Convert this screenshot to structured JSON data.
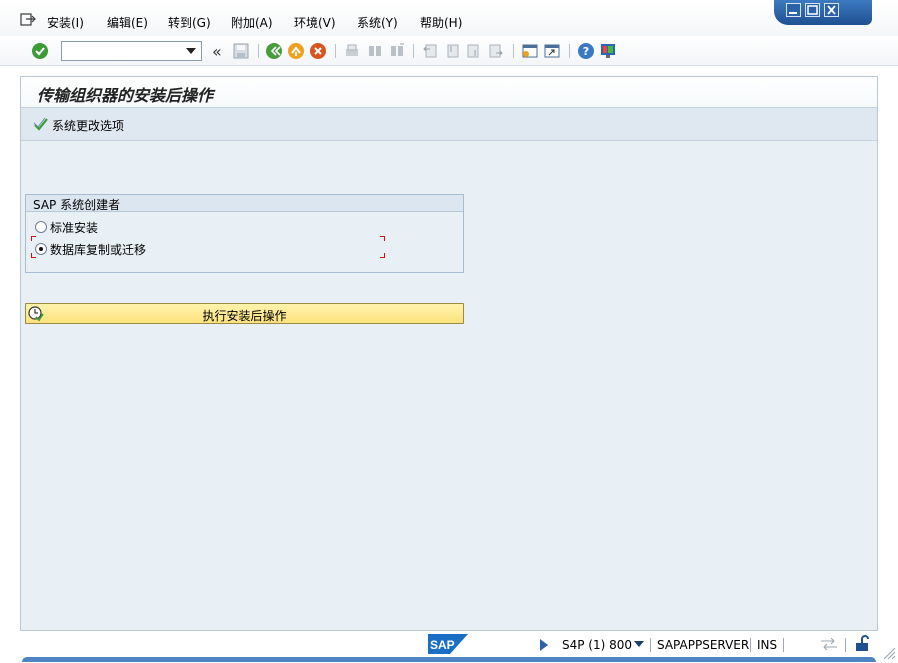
{
  "menubar": {
    "items": [
      {
        "label": "安装(I)"
      },
      {
        "label": "编辑(E)"
      },
      {
        "label": "转到(G)"
      },
      {
        "label": "附加(A)"
      },
      {
        "label": "环境(V)"
      },
      {
        "label": "系统(Y)"
      },
      {
        "label": "帮助(H)"
      }
    ]
  },
  "toolbar": {
    "command_field_value": "",
    "icons": [
      "enter-icon",
      "save-icon",
      "back-icon",
      "exit-icon",
      "cancel-icon",
      "print-icon",
      "find-icon",
      "find-next-icon",
      "first-page-icon",
      "previous-page-icon",
      "next-page-icon",
      "last-page-icon",
      "create-session-icon",
      "shortcut-icon",
      "help-icon",
      "customize-layout-icon"
    ]
  },
  "page": {
    "title": "传输组织器的安装后操作"
  },
  "app_toolbar": {
    "button_label": "系统更改选项"
  },
  "group": {
    "title": "SAP 系统创建者",
    "options": [
      {
        "label": "标准安装",
        "selected": false
      },
      {
        "label": "数据库复制或迁移",
        "selected": true
      }
    ]
  },
  "execute_button": {
    "label": "执行安装后操作"
  },
  "statusbar": {
    "logo": "SAP",
    "system": "S4P (1) 800",
    "server": "SAPAPPSERVER",
    "mode": "INS"
  },
  "colors": {
    "main_bg": "#e8eff5",
    "accent_blue": "#2c62a8",
    "exec_button": "#fbe27c",
    "focus_red": "#d01010"
  }
}
